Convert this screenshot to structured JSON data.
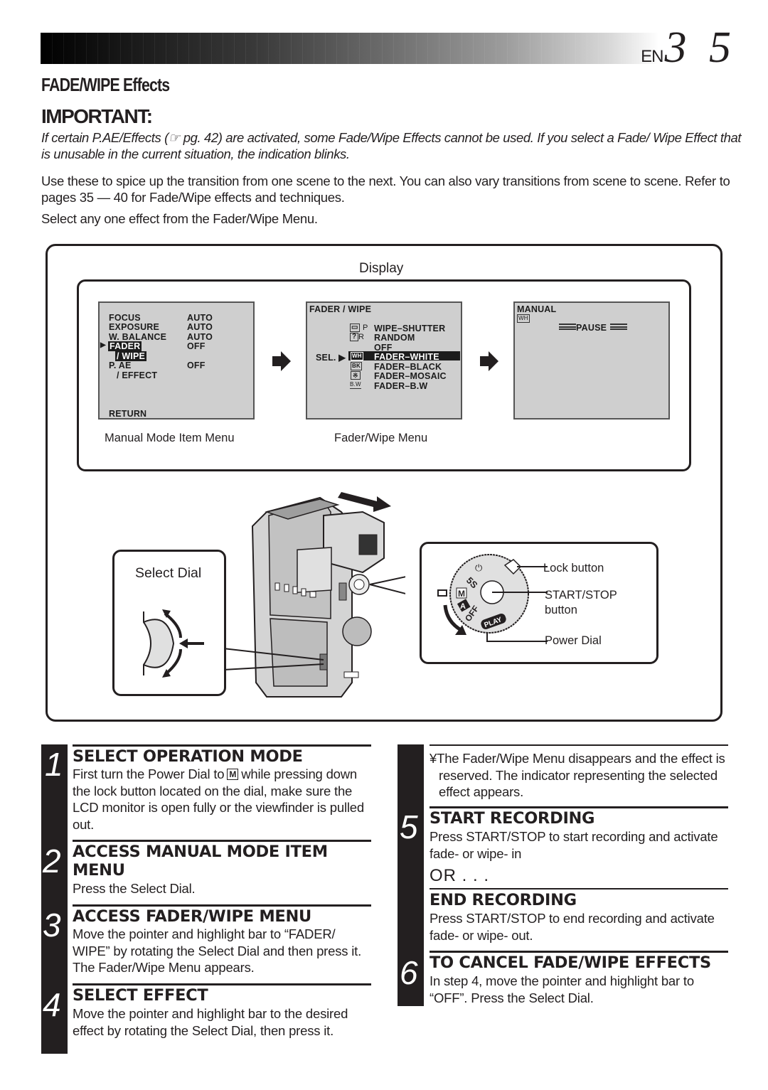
{
  "header": {
    "lang": "EN",
    "page_number": "3 5",
    "section_title": "FADE/WIPE Effects"
  },
  "important": {
    "title": "IMPORTANT:",
    "text": "If certain P.AE/Effects (☞ pg. 42) are activated, some Fade/Wipe Effects cannot be used. If you select a Fade/ Wipe Effect that is unusable in the current situation, the indication blinks."
  },
  "intro": {
    "paragraph1": "Use these to spice up the transition from one scene to the next. You can also vary transitions from scene to scene. Refer to pages 35 — 40 for Fade/Wipe effects and techniques.",
    "paragraph2": "Select any one effect from the Fader/Wipe Menu."
  },
  "diagram": {
    "display_label": "Display",
    "manual_menu": {
      "caption": "Manual Mode Item Menu",
      "rows": [
        {
          "label": "FOCUS",
          "value": "AUTO"
        },
        {
          "label": "EXPOSURE",
          "value": "AUTO"
        },
        {
          "label": "W. BALANCE",
          "value": "AUTO"
        },
        {
          "label": "FADER",
          "value": "OFF"
        },
        {
          "label": "/ WIPE",
          "value": ""
        },
        {
          "label": "P. AE",
          "value": "OFF"
        },
        {
          "label": "/ EFFECT",
          "value": ""
        }
      ],
      "return_label": "RETURN",
      "pointer": "▶"
    },
    "fader_menu": {
      "caption": "Fader/Wipe Menu",
      "title": "FADER / WIPE",
      "sel_label": "SEL. ▶",
      "items": [
        {
          "icon": "▭▾P",
          "label": "WIPE–SHUTTER"
        },
        {
          "icon": "?R",
          "label": "RANDOM"
        },
        {
          "icon": "",
          "label": "OFF"
        },
        {
          "icon": "WH",
          "label": "FADER–WHITE",
          "selected": true
        },
        {
          "icon": "BK",
          "label": "FADER–BLACK"
        },
        {
          "icon": "▒",
          "label": "FADER–MOSAIC"
        },
        {
          "icon": "B.W",
          "label": "FADER–B.W"
        }
      ]
    },
    "record_display": {
      "mode": "MANUAL",
      "indicator": "WH",
      "status": "PAUSE"
    },
    "select_dial_label": "Select Dial",
    "power_dial": {
      "lock_button": "Lock button",
      "start_stop_line1": "START/STOP",
      "start_stop_line2": "button",
      "power_dial": "Power Dial",
      "positions": [
        "5S",
        "M",
        "A",
        "OFF",
        "PLAY"
      ]
    }
  },
  "steps": [
    {
      "number": "1",
      "heading": "SELECT OPERATION MODE",
      "text_before_icon": "First turn the Power Dial to",
      "icon": "M",
      "text_after_icon": "while pressing down the lock button located on the dial, make sure the LCD monitor is open fully or the viewfinder is pulled out."
    },
    {
      "number": "2",
      "heading_line1": "ACCESS MANUAL MODE ITEM",
      "heading_line2": "MENU",
      "text": "Press the Select Dial."
    },
    {
      "number": "3",
      "heading": "ACCESS FADER/WIPE MENU",
      "text": "Move the pointer and highlight bar to “FADER/ WIPE” by rotating the Select Dial and then press it. The Fader/Wipe Menu appears."
    },
    {
      "number": "4",
      "heading": "SELECT EFFECT",
      "text": "Move the pointer and highlight bar to the desired effect by rotating the Select Dial, then press it.",
      "note": "¥The Fader/Wipe Menu disappears and the effect is reserved. The indicator representing the selected effect appears."
    },
    {
      "number": "5",
      "heading": "START RECORDING",
      "text": "Press START/STOP to start recording and activate fade- or wipe- in",
      "or": "OR . . .",
      "heading2": "END RECORDING",
      "text2": "Press START/STOP to end recording and activate fade- or wipe- out."
    },
    {
      "number": "6",
      "heading": "TO CANCEL FADE/WIPE EFFECTS",
      "text": "In step 4, move the pointer and highlight bar to “OFF”. Press the Select Dial."
    }
  ]
}
